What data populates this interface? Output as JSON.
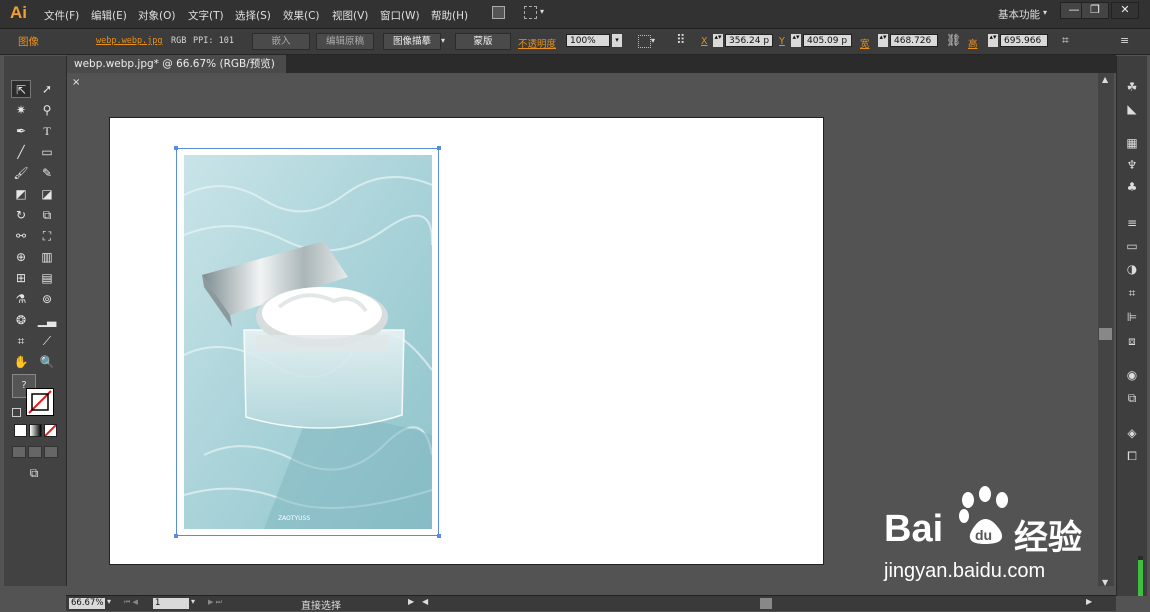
{
  "app": {
    "logo": "Ai"
  },
  "menu": [
    "文件(F)",
    "编辑(E)",
    "对象(O)",
    "文字(T)",
    "选择(S)",
    "效果(C)",
    "视图(V)",
    "窗口(W)",
    "帮助(H)"
  ],
  "workspace": "基本功能",
  "window_buttons": {
    "minimize": "—",
    "restore": "❐",
    "close": "✕"
  },
  "control_bar": {
    "object_type": "图像",
    "file_link": "webp.webp.jpg",
    "color_mode": "RGB",
    "ppi": "PPI: 101",
    "embed": "嵌入",
    "edit_original": "编辑原稿",
    "image_trace": "图像描摹",
    "mask": "蒙版",
    "opacity_label": "不透明度",
    "opacity_value": "100%",
    "x_label": "X",
    "x_value": "356.24 p",
    "y_label": "Y",
    "y_value": "405.09 p",
    "w_label": "宽",
    "w_value": "468.726",
    "h_label": "高",
    "h_value": "695.966"
  },
  "document_tab": {
    "title": "webp.webp.jpg* @ 66.67% (RGB/预览)",
    "close": "×"
  },
  "photo": {
    "caption": "ZAOTYUSS"
  },
  "status_bar": {
    "zoom": "66.67%",
    "page": "1",
    "tool": "直接选择"
  },
  "watermark": {
    "brand": "Bai",
    "brand2": "经验",
    "url": "jingyan.baidu.com"
  },
  "colors": {
    "accent": "#e8901a",
    "selection": "#5b8be0",
    "panel": "#535353"
  }
}
